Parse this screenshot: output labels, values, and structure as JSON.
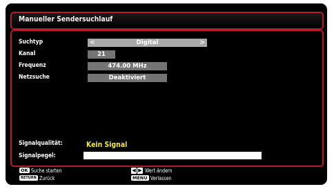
{
  "title": "Manueller Sendersuchlauf",
  "settings": {
    "search_type_label": "Suchtyp",
    "search_type_value": "Digital",
    "channel_label": "Kanal",
    "channel_value": "21",
    "frequency_label": "Frequenz",
    "frequency_value": "474.00 MHz",
    "network_label": "Netzsuche",
    "network_value": "Deaktiviert"
  },
  "signal": {
    "quality_label": "Signalqualität:",
    "quality_value": "Kein Signal",
    "level_label": "Signalpegel:",
    "level_fraction": 1.0
  },
  "footer": {
    "ok_key": "OK",
    "ok_text": "Suche starten",
    "return_key": "RETURN",
    "return_text": "Zurück",
    "lr_left": "◀",
    "lr_right": "▶",
    "lr_text": "Wert ändern",
    "menu_key": "MENU",
    "menu_text": "Verlassen"
  },
  "colors": {
    "accent": "#b31c2c",
    "signal_text": "#f2ea3a"
  }
}
